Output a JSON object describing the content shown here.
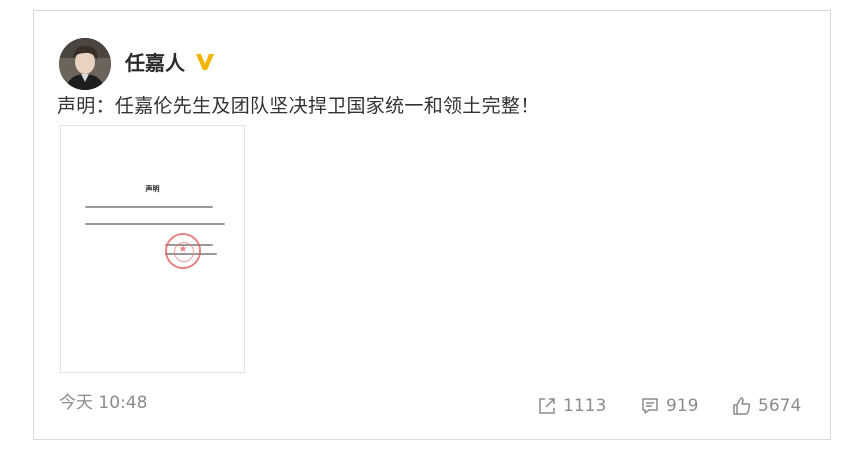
{
  "post": {
    "author": "任嘉人",
    "verified_color": "#f5b400",
    "text": "声明：任嘉伦先生及团队坚决捍卫国家统一和领土完整！",
    "timestamp": "今天 10:48"
  },
  "document_image": {
    "title": "声明"
  },
  "actions": {
    "share_count": "1113",
    "comment_count": "919",
    "like_count": "5674"
  },
  "icons": {
    "verified": "verified-v-badge-icon",
    "share": "share-icon",
    "comment": "comment-icon",
    "like": "thumbs-up-icon"
  }
}
